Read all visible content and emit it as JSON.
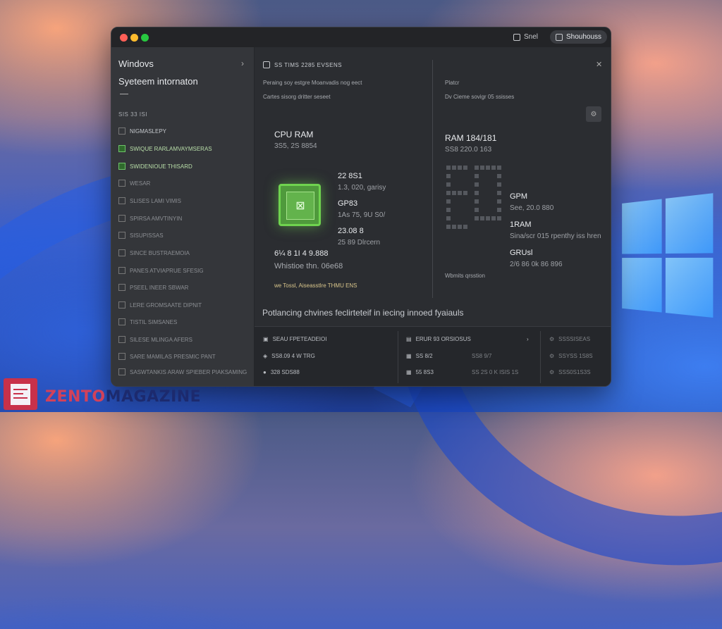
{
  "titlebar": {
    "notes_label": "Snel",
    "pill_label": "Shouhouss"
  },
  "sidebar": {
    "title": "Windovs",
    "subtitle": "Syeteem intornaton",
    "section": "SIS 33 ISI",
    "items": [
      "NIGMASLEPY",
      "SWIQUE RARLAMVAYMSERAS",
      "SWIDENIOUE THISARD",
      "WESAR",
      "SLISES LAMI VIMIS",
      "SPIRSA AMVTINYIN",
      "SISUPISSAS",
      "SINCE BUSTRAEMOIA",
      "PANES ATVIAPRUE SFESIG",
      "PSEEL INEER SBWAR",
      "LERE GROMSAATE DIPNIT",
      "TISTIL SIMSANES",
      "SILESE MLINGA AFERS",
      "SARE MAMILAS PRESMIC PANT",
      "SASWTANKIS ARAW SPIEBER PIAKSAMING"
    ]
  },
  "main": {
    "header": "SS TIMS 2285 EVSENS",
    "line1_left": "Peraing soy estgre Moanvadis nog eect",
    "line2_left": "Cartes sisorg dritter seseet",
    "line1_right": "Platcr",
    "line2_right": "Dv Cieme sovigr 05 ssisses",
    "cpu": {
      "title": "CPU RAM",
      "subtitle": "3S5, 2S 8854",
      "stat1_big": "22 8S1",
      "stat1_small": "1.3, 020, garisy",
      "stat2_big": "GP83",
      "stat2_small": "1As 75, 9U S0/",
      "stat3_big": "23.08 8",
      "stat3_small": "25 89 Dlrcern",
      "bottom1": "6¼ 8 1I 4 9.888",
      "bottom2": "Whistioe thn. 06e68",
      "tip": "we Tossl, Aiseasstlre THMU ENS"
    },
    "ram": {
      "title": "RAM 184/181",
      "subtitle": "SS8 220.0 163",
      "stat1_big": "GPM",
      "stat1_small": "See, 20.0 880",
      "stat2_big": "1RAM",
      "stat2_small": "Sina/scr 015 rpenthy iss hren",
      "stat3_big": "GRUsl",
      "stat3_small": "2/6 86 0k 86 896",
      "caption": "Wbmits qrsstion"
    },
    "footer_text": "Potlancing chvines feclirteteif in iecing innoed fyaiauls"
  },
  "bottom": {
    "col1": [
      "SEAU FPETEADEIOI",
      "SS8.09 4 W TRG",
      "328 SDS88"
    ],
    "col2": [
      "ERUR 93 ORSIOSUS",
      "SS 8/2",
      "55 8S3"
    ],
    "col2b": [
      "",
      "SS8 9/7",
      "SS 2S 0 K ISIS 1S"
    ],
    "col3": [
      "SSSSISEAS",
      "SSYSS 1S8S",
      "SSS0S1S3S"
    ]
  },
  "brand": {
    "part_a": "ZENTO",
    "part_b": "MAGAZINE"
  },
  "colors": {
    "accent_green": "#6fd34f",
    "window_bg": "#2b2d31",
    "brand_red": "#d2415a",
    "brand_navy": "#1c2a6e"
  }
}
